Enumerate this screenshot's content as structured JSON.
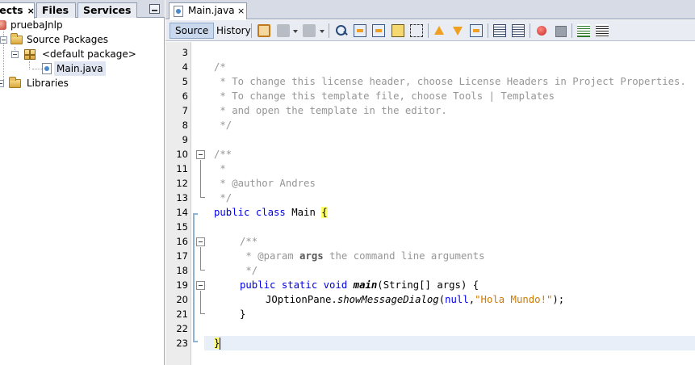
{
  "left_panel": {
    "tabs": [
      {
        "label": "jects",
        "close": "×"
      },
      {
        "label": "Files"
      },
      {
        "label": "Services"
      }
    ],
    "tree": {
      "project": "pruebaJnlp",
      "source_packages": "Source Packages",
      "default_package": "<default package>",
      "file": "Main.java",
      "libraries": "Libraries"
    }
  },
  "editor": {
    "tab": {
      "label": "Main.java",
      "close": "×"
    },
    "toolbar": {
      "source": "Source",
      "history": "History"
    },
    "lines": [
      {
        "n": "3"
      },
      {
        "n": "4"
      },
      {
        "n": "5"
      },
      {
        "n": "6"
      },
      {
        "n": "7"
      },
      {
        "n": "8"
      },
      {
        "n": "9"
      },
      {
        "n": "10"
      },
      {
        "n": "11"
      },
      {
        "n": "12"
      },
      {
        "n": "13"
      },
      {
        "n": "14"
      },
      {
        "n": "15"
      },
      {
        "n": "16"
      },
      {
        "n": "17"
      },
      {
        "n": "18"
      },
      {
        "n": "19"
      },
      {
        "n": "20"
      },
      {
        "n": "21"
      },
      {
        "n": "22"
      },
      {
        "n": "23"
      }
    ],
    "code": {
      "l4": "/*",
      "l5": " * To change this license header, choose License Headers in Project Properties.",
      "l6": " * To change this template file, choose Tools | Templates",
      "l7": " * and open the template in the editor.",
      "l8": " */",
      "l10": "/**",
      "l11": " *",
      "l12": " * @author Andres",
      "l13": " */",
      "l14_kw": "public class",
      "l14_name": " Main ",
      "l14_brace": "{",
      "l16": "/**",
      "l17_pre": " * @param ",
      "l17_arg": "args",
      "l17_post": " the command line arguments",
      "l18": " */",
      "l19_kw": "public static void",
      "l19_method": "main",
      "l19_rest": "(String[] args) {",
      "l20_cls": "JOptionPane.",
      "l20_method": "showMessageDialog",
      "l20_open": "(",
      "l20_null": "null",
      "l20_comma": ",",
      "l20_str": "\"Hola Mundo!\"",
      "l20_close": ");",
      "l21": "}",
      "l23": "}"
    }
  }
}
